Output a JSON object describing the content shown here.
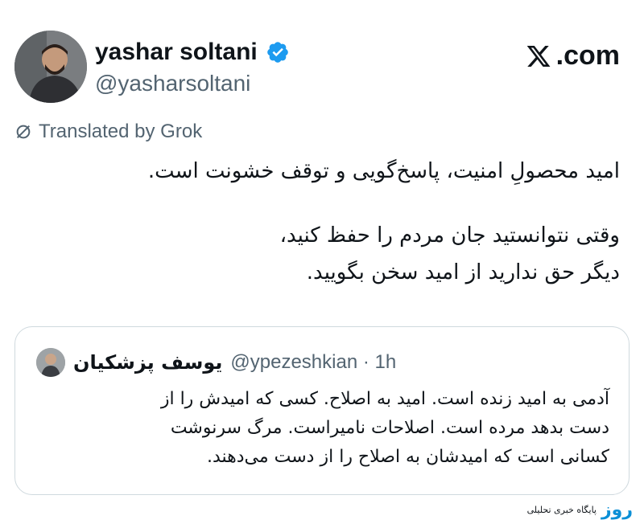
{
  "author": {
    "name": "yashar soltani",
    "handle": "@yasharsoltani"
  },
  "site_label": ".com",
  "translated_label": "Translated by Grok",
  "tweet_lines": {
    "l1": "امید محصولِ امنیت، پاسخ‌گویی و توقف خشونت است.",
    "l2": "وقتی نتوانستید جان مردم را حفظ کنید،",
    "l3": "دیگر حق ندارید از امید سخن بگویید."
  },
  "quote": {
    "name": "یوسف پزشکیان",
    "handle_time": "@ypezeshkian · 1h",
    "lines": {
      "l1": "آدمی به امید زنده است. امید به اصلاح. کسی که امیدش را از",
      "l2": "دست بدهد مرده است. اصلاحات نامیراست. مرگ سرنوشت",
      "l3": "کسانی است که امیدشان به اصلاح را از دست می‌دهند."
    }
  },
  "watermark": {
    "logo": "روز",
    "text": "پایگاه خبری تحلیلی"
  },
  "colors": {
    "verified": "#1d9bf0",
    "secondary_text": "#536471",
    "border": "#cfd9de"
  }
}
